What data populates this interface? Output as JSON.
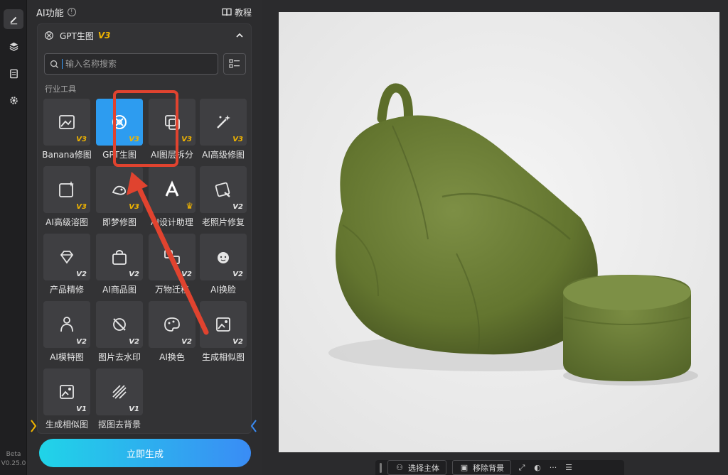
{
  "panel": {
    "title": "AI功能",
    "tutorial_label": "教程"
  },
  "card": {
    "title": "GPT生图",
    "version_tag": "V3"
  },
  "search": {
    "placeholder": "输入名称搜索"
  },
  "section_label": "行业工具",
  "tools": [
    {
      "label": "Banana修图",
      "version": "V3",
      "icon": "image-edit-icon"
    },
    {
      "label": "GPT生图",
      "version": "V3",
      "icon": "gpt-logo-icon",
      "selected": true
    },
    {
      "label": "AI图层拆分",
      "version": "V3",
      "icon": "layer-split-icon"
    },
    {
      "label": "AI高级修图",
      "version": "V3",
      "icon": "magic-wand-icon"
    },
    {
      "label": "AI高级溶图",
      "version": "V3",
      "icon": "sparkle-image-icon"
    },
    {
      "label": "即梦修图",
      "version": "V3",
      "icon": "dream-icon"
    },
    {
      "label": "AI设计助理",
      "version": "",
      "icon": "design-a-icon",
      "crown": true
    },
    {
      "label": "老照片修复",
      "version": "V2",
      "icon": "photo-repair-icon"
    },
    {
      "label": "产品精修",
      "version": "V2",
      "icon": "diamond-icon"
    },
    {
      "label": "AI商品图",
      "version": "V2",
      "icon": "shopping-bag-icon"
    },
    {
      "label": "万物迁移",
      "version": "V2",
      "icon": "transfer-icon"
    },
    {
      "label": "AI换脸",
      "version": "V2",
      "icon": "face-icon"
    },
    {
      "label": "AI模特图",
      "version": "V2",
      "icon": "model-icon"
    },
    {
      "label": "图片去水印",
      "version": "V2",
      "icon": "no-watermark-icon"
    },
    {
      "label": "AI换色",
      "version": "V2",
      "icon": "palette-icon"
    },
    {
      "label": "生成相似图",
      "version": "V2",
      "icon": "similar-image-icon"
    },
    {
      "label": "生成相似图",
      "version": "V1",
      "icon": "similar-image-v1-icon"
    },
    {
      "label": "抠图去背景",
      "version": "V1",
      "icon": "remove-bg-icon"
    }
  ],
  "cta_label": "立即生成",
  "version": {
    "beta": "Beta",
    "number": "V0.25.0"
  },
  "bottom_bar": {
    "select_subject": "选择主体",
    "remove_bg": "移除背景",
    "more": "···"
  },
  "colors": {
    "accent": "#2d9cf0",
    "highlight": "#e0432f",
    "version_gold": "#f0b400"
  }
}
